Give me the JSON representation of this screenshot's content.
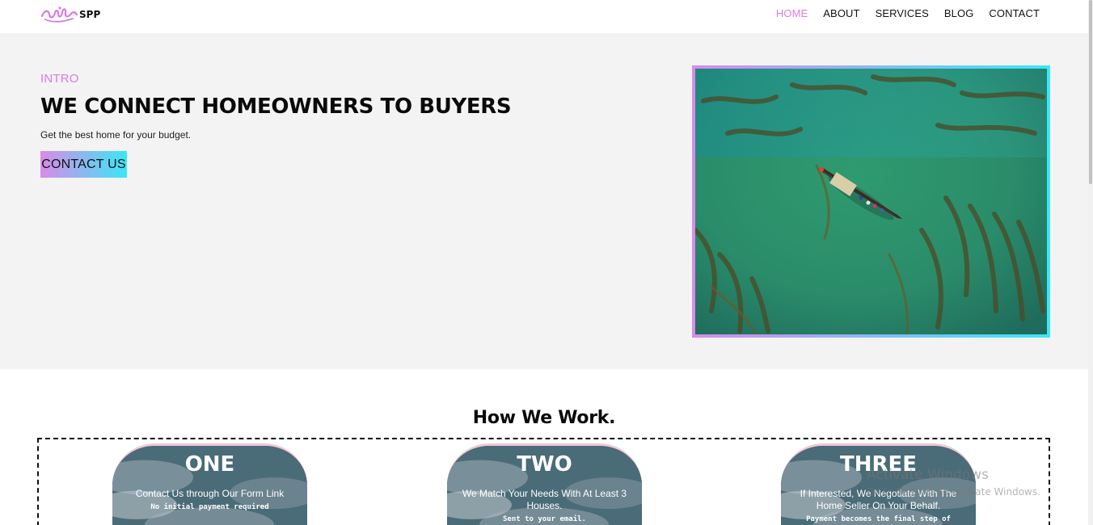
{
  "header": {
    "logo_icon": "script-flourish-logo",
    "logo_text": "SPP",
    "nav": [
      {
        "label": "HOME",
        "active": true
      },
      {
        "label": "ABOUT",
        "active": false
      },
      {
        "label": "SERVICES",
        "active": false
      },
      {
        "label": "BLOG",
        "active": false
      },
      {
        "label": "CONTACT",
        "active": false
      }
    ]
  },
  "hero": {
    "intro_label": "INTRO",
    "headline": "WE CONNECT HOMEOWNERS TO BUYERS",
    "subline": "Get the best home for your budget.",
    "cta_label": "CONTACT US",
    "image_icon": "aerial-boat-on-green-river-photo"
  },
  "how_we_work": {
    "title": "How We Work.",
    "steps": [
      {
        "title": "ONE",
        "desc": "Contact Us through Our Form Link",
        "note": "No initial payment required"
      },
      {
        "title": "TWO",
        "desc": "We Match Your Needs With At Least 3 Houses.",
        "note": "Sent to your email."
      },
      {
        "title": "THREE",
        "desc": "If Interested, We Negotiate With The Home Seller On Your Behalf.",
        "note": "Payment becomes the final step of negotiation"
      }
    ]
  },
  "watermark": {
    "title": "Activate Windows",
    "subtitle": "Go to Settings to activate Windows."
  },
  "colors": {
    "accent": "#d77be6",
    "gradient_start": "#d98be8",
    "gradient_end": "#3ae7f7",
    "hero_bg": "#f3f3f3"
  }
}
